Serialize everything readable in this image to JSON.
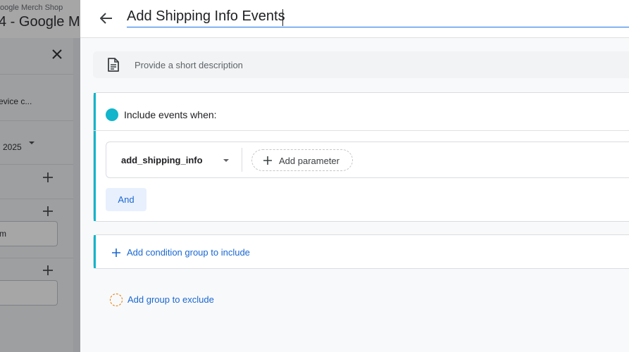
{
  "background": {
    "account_name": "oogle Merch Shop",
    "property_name": "4 - Google Me",
    "rows": [
      {
        "text": "evice c..."
      },
      {
        "text": "2025"
      }
    ],
    "field_value": "m",
    "field_value_2": ""
  },
  "dialog": {
    "title": "Add Shipping Info Events",
    "description_placeholder": "Provide a short description",
    "include": {
      "title": "Include events when:",
      "condition": {
        "event_name": "add_shipping_info",
        "add_parameter_label": "Add parameter"
      },
      "and_label": "And"
    },
    "add_condition_group_label": "Add condition group to include",
    "add_exclude_group_label": "Add group to exclude"
  },
  "colors": {
    "accent_teal": "#12b5cb",
    "link_blue": "#1967d2",
    "exclude_orange": "#e37400",
    "and_bg": "#e8f0fe"
  },
  "icons": [
    "close-icon",
    "plus-icon",
    "arrow-back-icon",
    "description-icon",
    "chevron-down-icon"
  ]
}
